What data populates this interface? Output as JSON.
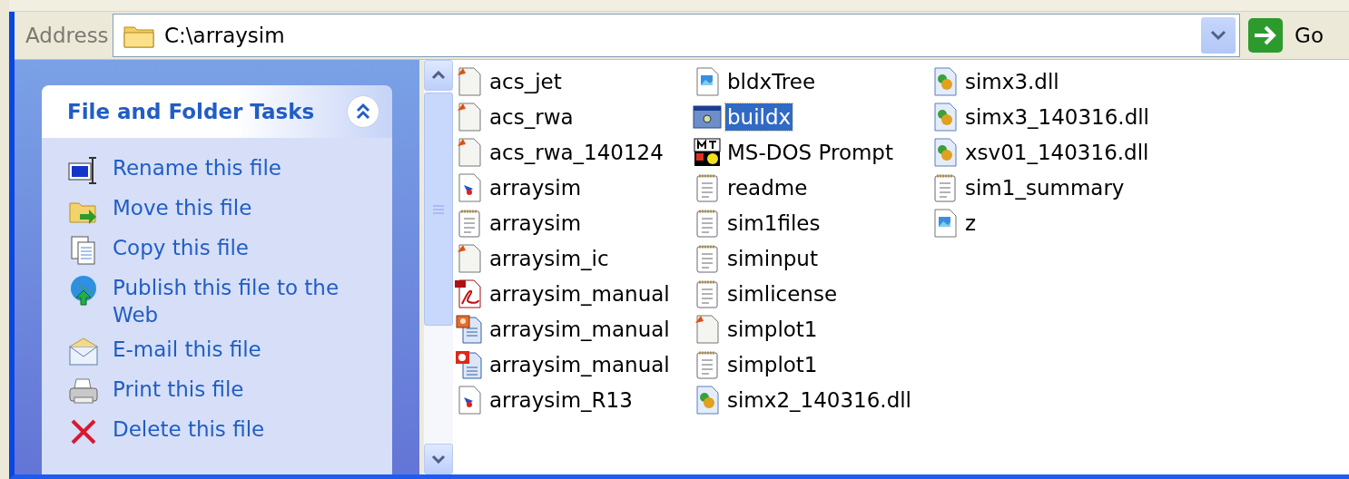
{
  "address_bar": {
    "label": "Address",
    "path": "C:\\arraysim",
    "go": "Go"
  },
  "task_panel": {
    "title": "File and Folder Tasks",
    "expanded": true,
    "items": [
      {
        "kind": "rename",
        "label": "Rename this file"
      },
      {
        "kind": "move",
        "label": "Move this file"
      },
      {
        "kind": "copy",
        "label": "Copy this file"
      },
      {
        "kind": "publish",
        "label": "Publish this file to the Web"
      },
      {
        "kind": "email",
        "label": "E-mail this file"
      },
      {
        "kind": "print",
        "label": "Print this file"
      },
      {
        "kind": "delete",
        "label": "Delete this file"
      }
    ]
  },
  "files": [
    {
      "kind": "mfile",
      "name": "acs_jet",
      "selected": false
    },
    {
      "kind": "mfile",
      "name": "acs_rwa",
      "selected": false
    },
    {
      "kind": "mfile",
      "name": "acs_rwa_140124",
      "selected": false
    },
    {
      "kind": "fig",
      "name": "arraysim",
      "selected": false
    },
    {
      "kind": "text",
      "name": "arraysim",
      "selected": false
    },
    {
      "kind": "mfile",
      "name": "arraysim_ic",
      "selected": false
    },
    {
      "kind": "pdf",
      "name": "arraysim_manual",
      "selected": false
    },
    {
      "kind": "doc",
      "name": "arraysim_manual",
      "selected": false
    },
    {
      "kind": "ppt",
      "name": "arraysim_manual",
      "selected": false
    },
    {
      "kind": "fig",
      "name": "arraysim_R13",
      "selected": false
    },
    {
      "kind": "image",
      "name": "bldxTree",
      "selected": false
    },
    {
      "kind": "exe",
      "name": "buildx",
      "selected": true
    },
    {
      "kind": "dos",
      "name": "MS-DOS Prompt",
      "selected": false
    },
    {
      "kind": "text",
      "name": "readme",
      "selected": false
    },
    {
      "kind": "text",
      "name": "sim1files",
      "selected": false
    },
    {
      "kind": "text",
      "name": "siminput",
      "selected": false
    },
    {
      "kind": "text",
      "name": "simlicense",
      "selected": false
    },
    {
      "kind": "mfile",
      "name": "simplot1",
      "selected": false
    },
    {
      "kind": "text",
      "name": "simplot1",
      "selected": false
    },
    {
      "kind": "dll",
      "name": "simx2_140316.dll",
      "selected": false
    },
    {
      "kind": "dll",
      "name": "simx3.dll",
      "selected": false
    },
    {
      "kind": "dll",
      "name": "simx3_140316.dll",
      "selected": false
    },
    {
      "kind": "dll",
      "name": "xsv01_140316.dll",
      "selected": false
    },
    {
      "kind": "text",
      "name": "sim1_summary",
      "selected": false
    },
    {
      "kind": "image",
      "name": "z",
      "selected": false
    }
  ]
}
